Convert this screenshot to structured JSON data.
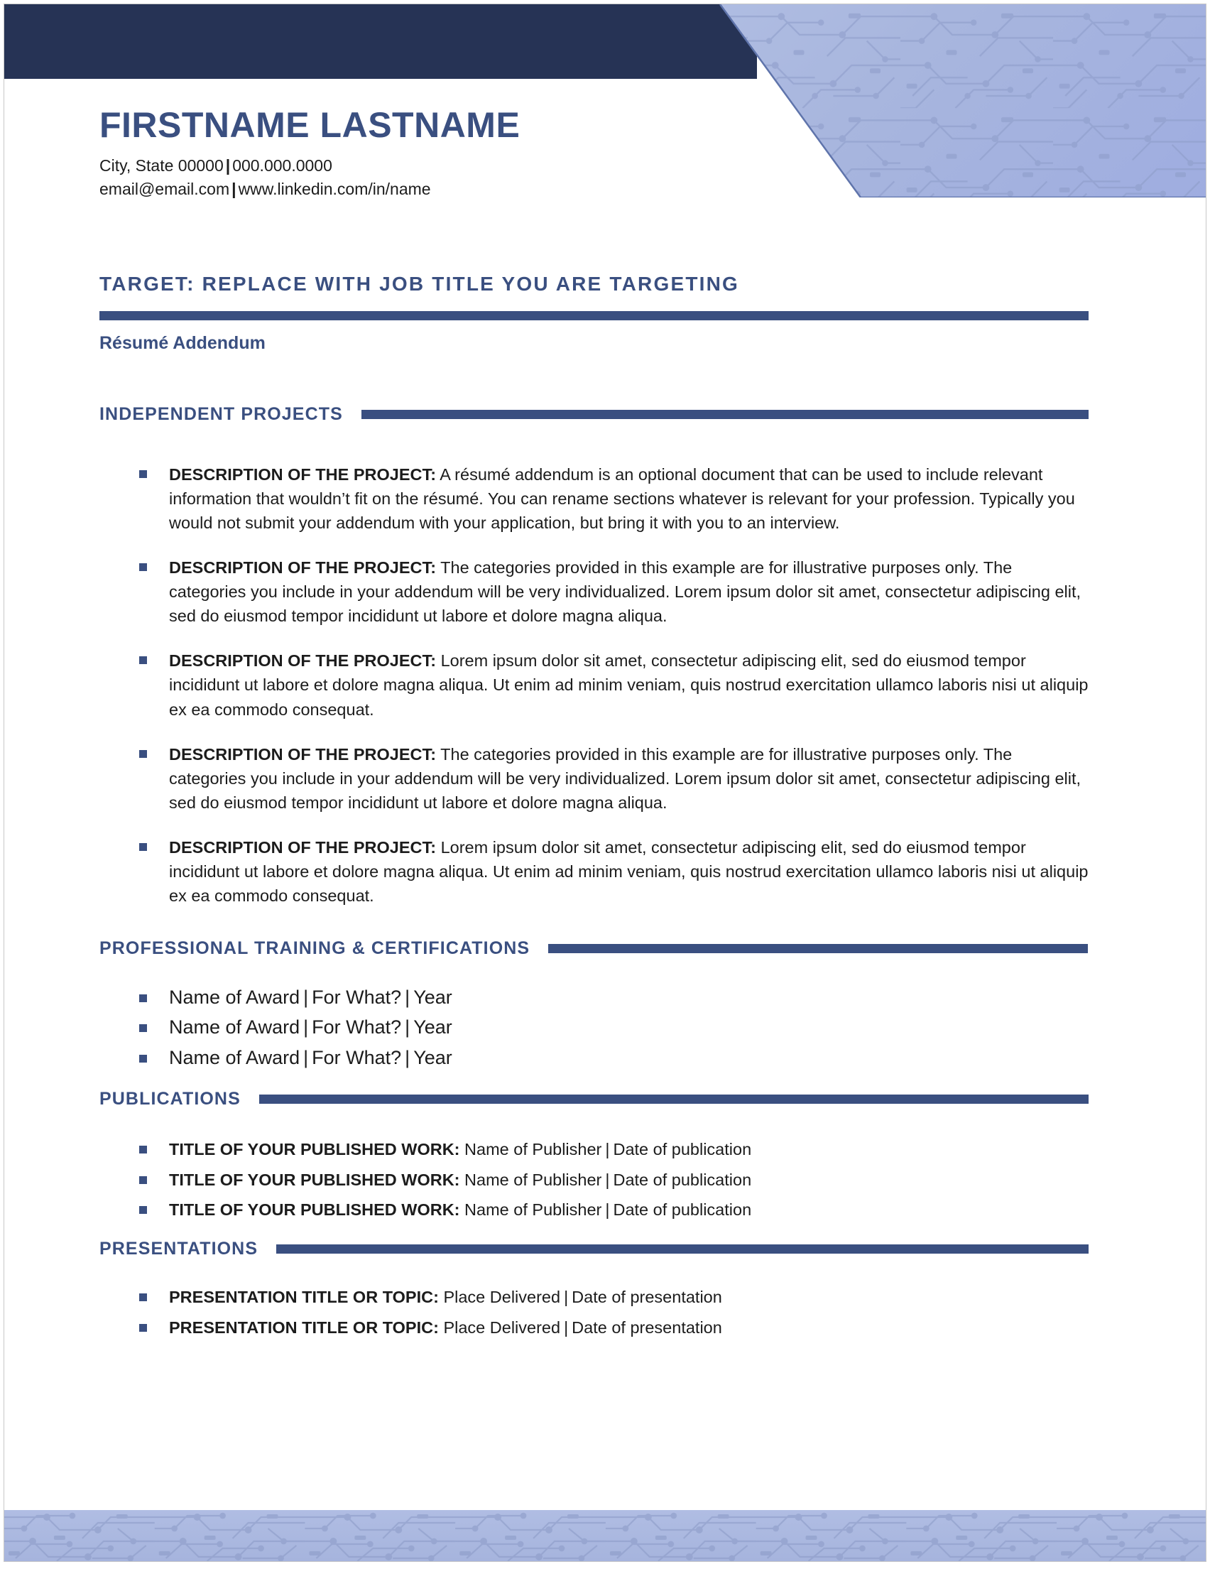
{
  "theme": {
    "navy": "#263355",
    "accent_blue": "#3a4f80",
    "panel_blue": "#a8b6de",
    "body_text": "#1c1c1c"
  },
  "header": {
    "full_name": "FIRSTNAME LASTNAME",
    "contact_line_1_location": "City, State 00000",
    "contact_line_1_phone": "000.000.0000",
    "contact_line_2_email": "email@email.com",
    "contact_line_2_linkedin": "www.linkedin.com/in/name",
    "separator": "|"
  },
  "target": {
    "title": "TARGET: REPLACE WITH JOB TITLE YOU ARE TARGETING",
    "subtitle": "Résumé Addendum"
  },
  "sections": {
    "independent_projects": {
      "heading": "INDEPENDENT PROJECTS",
      "items": [
        {
          "label": "DESCRIPTION OF THE PROJECT:",
          "text": " A résumé addendum is an optional document that can be used to include relevant information that wouldn’t fit on the résumé. You can rename sections whatever is relevant for your profession. Typically you would not submit your addendum with your application, but bring it with you to an interview."
        },
        {
          "label": "DESCRIPTION OF THE PROJECT:",
          "text": " The categories provided in this example are for illustrative purposes only. The categories you include in your addendum will be very individualized. Lorem ipsum dolor sit amet, consectetur adipiscing elit, sed do eiusmod tempor incididunt ut labore et dolore magna aliqua."
        },
        {
          "label": "DESCRIPTION OF THE PROJECT:",
          "text": " Lorem ipsum dolor sit amet, consectetur adipiscing elit, sed do eiusmod tempor incididunt ut labore et dolore magna aliqua. Ut enim ad minim veniam, quis nostrud exercitation ullamco laboris nisi ut aliquip ex ea commodo consequat."
        },
        {
          "label": "DESCRIPTION OF THE PROJECT:",
          "text": " The categories provided in this example are for illustrative purposes only. The categories you include in your addendum will be very individualized. Lorem ipsum dolor sit amet, consectetur adipiscing elit, sed do eiusmod tempor incididunt ut labore et dolore magna aliqua."
        },
        {
          "label": "DESCRIPTION OF THE PROJECT:",
          "text": " Lorem ipsum dolor sit amet, consectetur adipiscing elit, sed do eiusmod tempor incididunt ut labore et dolore magna aliqua. Ut enim ad minim veniam, quis nostrud exercitation ullamco laboris nisi ut aliquip ex ea commodo consequat."
        }
      ]
    },
    "professional_training": {
      "heading": "PROFESSIONAL TRAINING & CERTIFICATIONS",
      "items": [
        {
          "name": "Name of Award",
          "what": "For What?",
          "year": "Year"
        },
        {
          "name": "Name of Award",
          "what": "For What?",
          "year": "Year"
        },
        {
          "name": "Name of Award",
          "what": "For What?",
          "year": "Year"
        }
      ]
    },
    "publications": {
      "heading": "PUBLICATIONS",
      "items": [
        {
          "label": "TITLE OF YOUR PUBLISHED WORK:",
          "publisher": "Name of Publisher",
          "date": "Date of publication"
        },
        {
          "label": "TITLE OF YOUR PUBLISHED WORK:",
          "publisher": "Name of Publisher",
          "date": "Date of publication"
        },
        {
          "label": "TITLE OF YOUR PUBLISHED WORK:",
          "publisher": "Name of Publisher",
          "date": "Date of publication"
        }
      ]
    },
    "presentations": {
      "heading": "PRESENTATIONS",
      "items": [
        {
          "label": "PRESENTATION TITLE OR TOPIC:",
          "place": "Place Delivered",
          "date": "Date of presentation"
        },
        {
          "label": "PRESENTATION TITLE OR TOPIC:",
          "place": "Place Delivered",
          "date": "Date of presentation"
        }
      ]
    }
  },
  "decor": {
    "header_pattern": "circuit-board-pattern",
    "footer_pattern": "circuit-board-pattern"
  }
}
